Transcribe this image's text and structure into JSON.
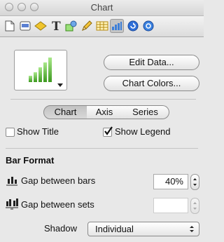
{
  "window": {
    "title": "Chart"
  },
  "toolbar": {
    "icons": [
      "document-icon",
      "layout-icon",
      "graphic-icon",
      "text-icon",
      "shapes-icon",
      "pencil-icon",
      "table-icon",
      "chart-icon",
      "metrics-icon",
      "more-icon"
    ],
    "selected": "chart-icon"
  },
  "chart_type": {
    "edit_data_label": "Edit Data...",
    "chart_colors_label": "Chart Colors..."
  },
  "tabs": [
    {
      "label": "Chart",
      "active": true
    },
    {
      "label": "Axis",
      "active": false
    },
    {
      "label": "Series",
      "active": false
    }
  ],
  "options": {
    "show_title": {
      "label": "Show Title",
      "checked": false
    },
    "show_legend": {
      "label": "Show Legend",
      "checked": true
    }
  },
  "bar_format": {
    "heading": "Bar Format",
    "gap_between_bars": {
      "label": "Gap between bars",
      "value": "40%"
    },
    "gap_between_sets": {
      "label": "Gap between sets",
      "value": ""
    },
    "shadow": {
      "label": "Shadow",
      "value": "Individual"
    }
  },
  "colors": {
    "bar_green_light": "#9ee07a",
    "bar_green_dark": "#3d9a1f"
  }
}
